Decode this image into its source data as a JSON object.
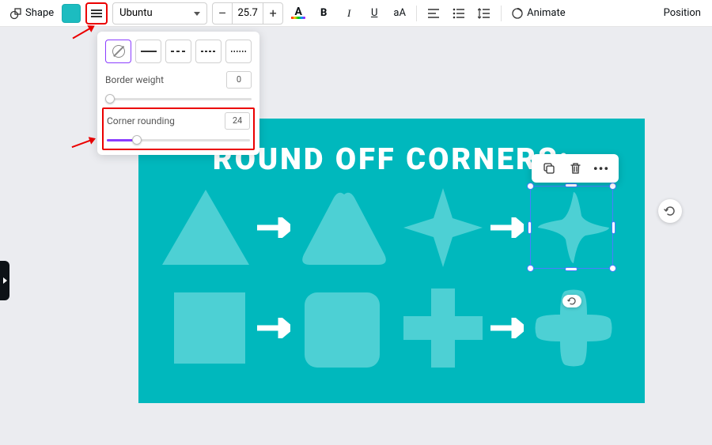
{
  "toolbar": {
    "shape_label": "Shape",
    "shape_color": "#1cbcc0",
    "font_name": "Ubuntu",
    "font_size": "25.7",
    "minus": "–",
    "plus": "+",
    "text_color_letter": "A",
    "bold": "B",
    "italic": "I",
    "underline": "U",
    "case": "aA",
    "animate_label": "Animate",
    "position_label": "Position"
  },
  "popover": {
    "border_weight_label": "Border weight",
    "border_weight_value": "0",
    "corner_rounding_label": "Corner rounding",
    "corner_rounding_value": "24"
  },
  "canvas": {
    "title": "ROUND OFF CORNERS:",
    "bg": "#00b8bd",
    "shape_fill": "#4dd0d4"
  },
  "context_bar": {
    "more": "•••"
  }
}
